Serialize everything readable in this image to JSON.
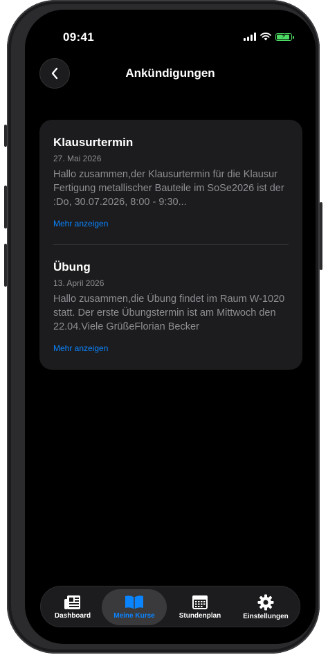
{
  "status_bar": {
    "time": "09:41",
    "signal_icon": "signal-icon",
    "wifi_icon": "wifi-icon",
    "battery_icon": "battery-charging-icon",
    "battery_color": "#4cd964"
  },
  "header": {
    "title": "Ankündigungen",
    "back_icon": "chevron-left-icon"
  },
  "announcements": [
    {
      "title": "Klausurtermin",
      "date": "27. Mai 2026",
      "body": "Hallo zusammen,der Klausurtermin für die Klausur Fertigung metallischer Bauteile im SoSe2026 ist der :Do, 30.07.2026, 8:00 - 9:30...",
      "more_label": "Mehr anzeigen"
    },
    {
      "title": "Übung",
      "date": "13. April 2026",
      "body": "Hallo zusammen,die Übung findet im Raum W-1020 statt. Der erste Übungstermin ist am Mittwoch den 22.04.Viele GrüßeFlorian Becker",
      "more_label": "Mehr anzeigen"
    }
  ],
  "tabbar": {
    "tabs": [
      {
        "label": "Dashboard",
        "icon": "newspaper-icon",
        "active": false
      },
      {
        "label": "Meine Kurse",
        "icon": "book-icon",
        "active": true
      },
      {
        "label": "Stundenplan",
        "icon": "calendar-icon",
        "active": false
      },
      {
        "label": "Einstellungen",
        "icon": "gear-icon",
        "active": false
      }
    ]
  },
  "colors": {
    "accent": "#0a84ff",
    "background": "#000000",
    "card": "#1c1c1e"
  }
}
